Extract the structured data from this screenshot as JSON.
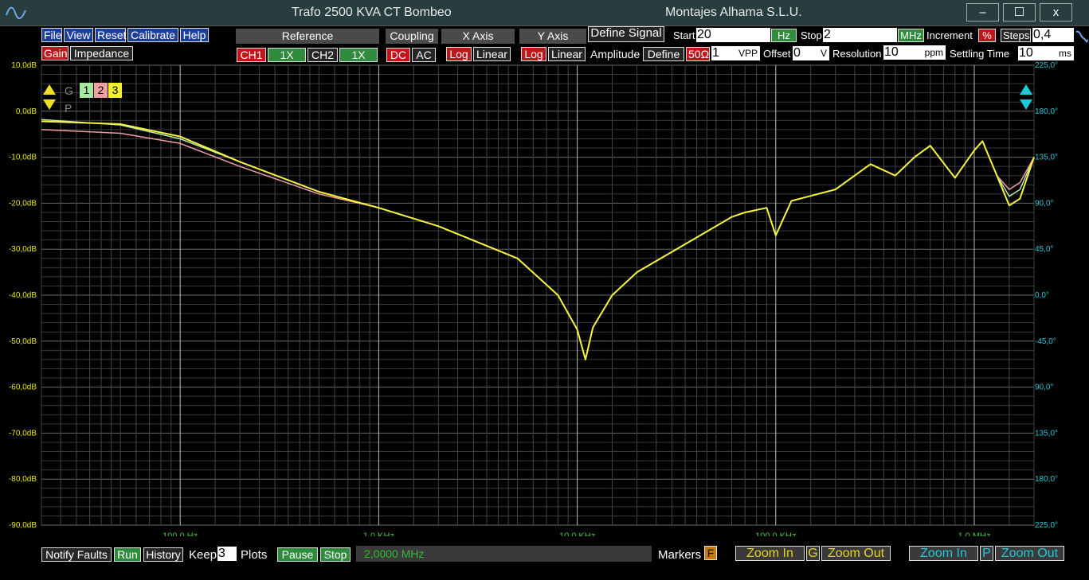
{
  "window": {
    "title": "Trafo 2500 KVA CT Bombeo",
    "company": "Montajes Alhama S.L.U.",
    "minimize": "–",
    "maximize": "☐",
    "close": "x"
  },
  "menu": {
    "file": "File",
    "view": "View",
    "reset": "Reset",
    "calibrate": "Calibrate",
    "help": "Help"
  },
  "mode": {
    "gain": "Gain",
    "impedance": "Impedance"
  },
  "reference": {
    "header": "Reference",
    "ch1": "CH1",
    "ch1_scale": "1X",
    "ch2": "CH2",
    "ch2_scale": "1X"
  },
  "coupling": {
    "header": "Coupling",
    "dc": "DC",
    "ac": "AC"
  },
  "xaxis": {
    "header": "X Axis",
    "log": "Log",
    "linear": "Linear"
  },
  "yaxis": {
    "header": "Y Axis",
    "log": "Log",
    "linear": "Linear"
  },
  "signal": {
    "define_signal": "Define Signal",
    "amplitude_label": "Amplitude",
    "define": "Define",
    "impedance": "50Ω",
    "amplitude_value": "1",
    "amplitude_unit": "VPP",
    "offset_label": "Offset",
    "offset_value": "0",
    "offset_unit": "V"
  },
  "sweep": {
    "start_label": "Start",
    "start_value": "20",
    "start_unit": "Hz",
    "stop_label": "Stop",
    "stop_value": "2",
    "stop_unit": "MHz",
    "increment_label": "Increment",
    "increment_unit": "%",
    "steps_label": "Steps",
    "steps_value": "0,4",
    "resolution_label": "Resolution",
    "resolution_value": "10",
    "resolution_unit": "ppm",
    "settling_label": "Settling Time",
    "settling_value": "10",
    "settling_unit": "ms"
  },
  "plot_selector": {
    "g": "G",
    "p": "P",
    "plot1": "1",
    "plot2": "2",
    "plot3": "3"
  },
  "bottom": {
    "notify_faults": "Notify Faults",
    "run": "Run",
    "history": "History",
    "keep_label": "Keep",
    "keep_value": "3",
    "plots_label": "Plots",
    "pause": "Pause",
    "stop": "Stop",
    "status": "2,0000 MHz",
    "markers_label": "Markers",
    "markers_flag": "F",
    "gain_zoom_in": "Zoom In",
    "gain_axis": "G",
    "gain_zoom_out": "Zoom Out",
    "phase_zoom_in": "Zoom In",
    "phase_axis": "P",
    "phase_zoom_out": "Zoom Out"
  },
  "colors": {
    "gain_axis": "#e6e61e",
    "phase_axis": "#20c8d8",
    "freq_axis": "#3ec43e",
    "trace_1": "#b8e8b0",
    "trace_2": "#f0a0a0",
    "trace_3": "#f4f43c"
  },
  "chart_data": {
    "type": "line",
    "xscale": "log",
    "xlim": [
      20,
      2000000
    ],
    "ylim": [
      -90,
      10
    ],
    "y2lim": [
      -225,
      225
    ],
    "grid": true,
    "x_tick_labels": [
      "100,0 Hz",
      "1,0 KHz",
      "10,0 KHz",
      "100,0 KHz",
      "1,0 MHz"
    ],
    "x_tick_values": [
      100,
      1000,
      10000,
      100000,
      1000000
    ],
    "y_tick_labels": [
      "10,0dB",
      "0,0dB",
      "-10,0dB",
      "-20,0dB",
      "-30,0dB",
      "-40,0dB",
      "-50,0dB",
      "-60,0dB",
      "-70,0dB",
      "-80,0dB",
      "-90,0dB"
    ],
    "y_tick_values": [
      10,
      0,
      -10,
      -20,
      -30,
      -40,
      -50,
      -60,
      -70,
      -80,
      -90
    ],
    "y2_tick_labels": [
      "225,0°",
      "180,0°",
      "135,0°",
      "90,0°",
      "45,0°",
      "0,0°",
      "-45,0°",
      "90,0°",
      "135,0°",
      "180,0°",
      "225,0°"
    ],
    "y2_tick_values": [
      225,
      180,
      135,
      90,
      45,
      0,
      -45,
      -90,
      -135,
      -180,
      -225
    ],
    "series": [
      {
        "name": "1",
        "x": [
          20,
          50,
          100,
          200,
          500,
          1000,
          2000,
          5000,
          8000,
          10000,
          11000,
          12000,
          15000,
          20000,
          50000,
          60000,
          70000,
          90000,
          100000,
          120000,
          200000,
          300000,
          400000,
          500000,
          600000,
          800000,
          1000000,
          1100000,
          1300000,
          1500000,
          1700000,
          2000000
        ],
        "y": [
          -1.8,
          -3,
          -6,
          -11,
          -17.5,
          -21,
          -25,
          -32,
          -40,
          -47.5,
          -54,
          -47,
          -40,
          -35,
          -25,
          -23,
          -22,
          -21,
          -27,
          -19.5,
          -17,
          -11.5,
          -14,
          -10,
          -7.5,
          -14.5,
          -8.5,
          -6.5,
          -14,
          -18.5,
          -17,
          -10
        ]
      },
      {
        "name": "2",
        "x": [
          20,
          50,
          100,
          200,
          500,
          1000,
          2000,
          5000,
          8000,
          10000,
          11000,
          12000,
          15000,
          20000,
          50000,
          60000,
          70000,
          90000,
          100000,
          120000,
          200000,
          300000,
          400000,
          500000,
          600000,
          800000,
          1000000,
          1100000,
          1300000,
          1500000,
          1700000,
          2000000
        ],
        "y": [
          -4,
          -4.8,
          -7,
          -12,
          -18,
          -21,
          -25,
          -32,
          -40,
          -47.5,
          -54,
          -47,
          -40,
          -35,
          -25,
          -23,
          -22,
          -21,
          -27,
          -19.5,
          -17,
          -11.5,
          -14,
          -10,
          -7.5,
          -14.5,
          -8.5,
          -6.5,
          -14,
          -17,
          -15.5,
          -10
        ]
      },
      {
        "name": "3",
        "x": [
          20,
          50,
          100,
          200,
          500,
          1000,
          2000,
          5000,
          8000,
          10000,
          11000,
          12000,
          15000,
          20000,
          50000,
          60000,
          70000,
          90000,
          100000,
          120000,
          200000,
          300000,
          400000,
          500000,
          600000,
          800000,
          1000000,
          1100000,
          1300000,
          1500000,
          1700000,
          2000000
        ],
        "y": [
          -2.2,
          -2.8,
          -5.5,
          -11,
          -17.5,
          -21,
          -25,
          -32,
          -40,
          -47.5,
          -54,
          -47,
          -40,
          -35,
          -25,
          -23,
          -22,
          -21,
          -27,
          -19.5,
          -17,
          -11.5,
          -14,
          -10,
          -7.5,
          -14.5,
          -8.5,
          -6.5,
          -14,
          -20.5,
          -19,
          -10
        ]
      }
    ]
  }
}
